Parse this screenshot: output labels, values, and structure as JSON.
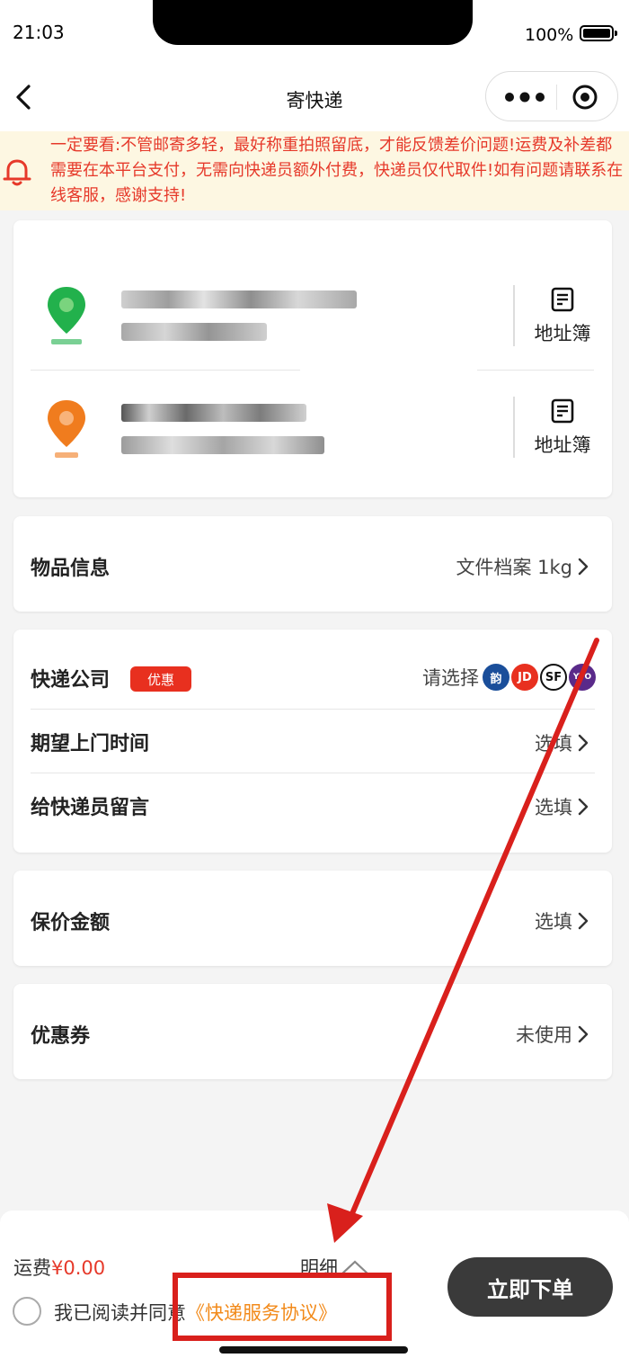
{
  "status_bar": {
    "time": "21:03",
    "battery": "100%"
  },
  "nav": {
    "title": "寄快递"
  },
  "notice": {
    "text": "一定要看:不管邮寄多轻，最好称重拍照留底，才能反馈差价问题!运费及补差都需要在本平台支付，无需向快递员额外付费，快递员仅代取件!如有问题请联系在线客服，感谢支持!"
  },
  "address": {
    "book_label": "地址簿",
    "sender_color": "#22b14c",
    "receiver_color": "#f07c1e"
  },
  "item_info": {
    "label": "物品信息",
    "value": "文件档案 1kg"
  },
  "courier": {
    "label": "快递公司",
    "badge": "优惠",
    "value": "请选择",
    "logos": [
      {
        "name": "yunda-logo",
        "text": "韵",
        "color": "#1a4e9a"
      },
      {
        "name": "jd-logo",
        "text": "JD",
        "color": "#e8301f"
      },
      {
        "name": "sf-logo",
        "text": "SF",
        "color": "#111111"
      },
      {
        "name": "yto-logo",
        "text": "YTO",
        "color": "#5a2a8a"
      }
    ]
  },
  "pickup_time": {
    "label": "期望上门时间",
    "value": "选填"
  },
  "courier_note": {
    "label": "给快递员留言",
    "value": "选填"
  },
  "insurance": {
    "label": "保价金额",
    "value": "选填"
  },
  "coupon": {
    "label": "优惠券",
    "value": "未使用"
  },
  "bottom": {
    "fee_label": "运费",
    "fee_value": "¥0.00",
    "detail": "明细",
    "agree_prefix": "我已阅读并同意",
    "agree_link": "《快递服务协议》",
    "submit": "立即下单"
  },
  "colors": {
    "accent_red": "#e6392a",
    "link_orange": "#f28a1a",
    "annotation_red": "#d9201c"
  }
}
